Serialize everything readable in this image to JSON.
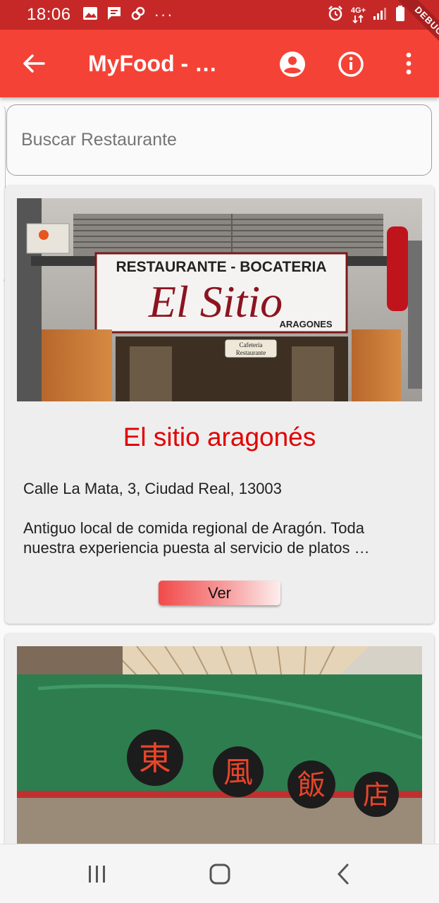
{
  "status_bar": {
    "time": "18:06",
    "more_indicator": "···",
    "network_label": "4G+",
    "icons": [
      "image-icon",
      "message-icon",
      "link-icon",
      "alarm-icon",
      "signal-icon",
      "battery-icon"
    ]
  },
  "app_bar": {
    "title": "MyFood - …",
    "debug_label": "DEBUG",
    "icons": [
      "back-arrow-icon",
      "account-circle-icon",
      "info-icon",
      "more-vert-icon"
    ],
    "color": "#f44336",
    "status_color": "#c62828"
  },
  "search": {
    "placeholder": "Buscar Restaurante",
    "value": ""
  },
  "restaurants": [
    {
      "image_sign_top": "RESTAURANTE - BOCATERIA",
      "image_sign_main": "El Sitio",
      "image_sign_sub": "ARAGONES",
      "image_door_sign": "Cafetería Restaurante",
      "name": "El sitio aragonés",
      "address": "Calle La Mata, 3, Ciudad Real, 13003",
      "description": "Antiguo local de comida regional de Aragón. Toda nuestra experiencia puesta al servicio de platos …",
      "button_label": "Ver"
    },
    {
      "image_sign_chars": [
        "東",
        "風",
        "飯",
        "店"
      ]
    }
  ],
  "nav_bar": {
    "icons": [
      "recents-icon",
      "home-icon",
      "back-icon"
    ]
  },
  "colors": {
    "accent": "#f44336",
    "title_red": "#e00000",
    "card_bg": "#eeeeee"
  }
}
